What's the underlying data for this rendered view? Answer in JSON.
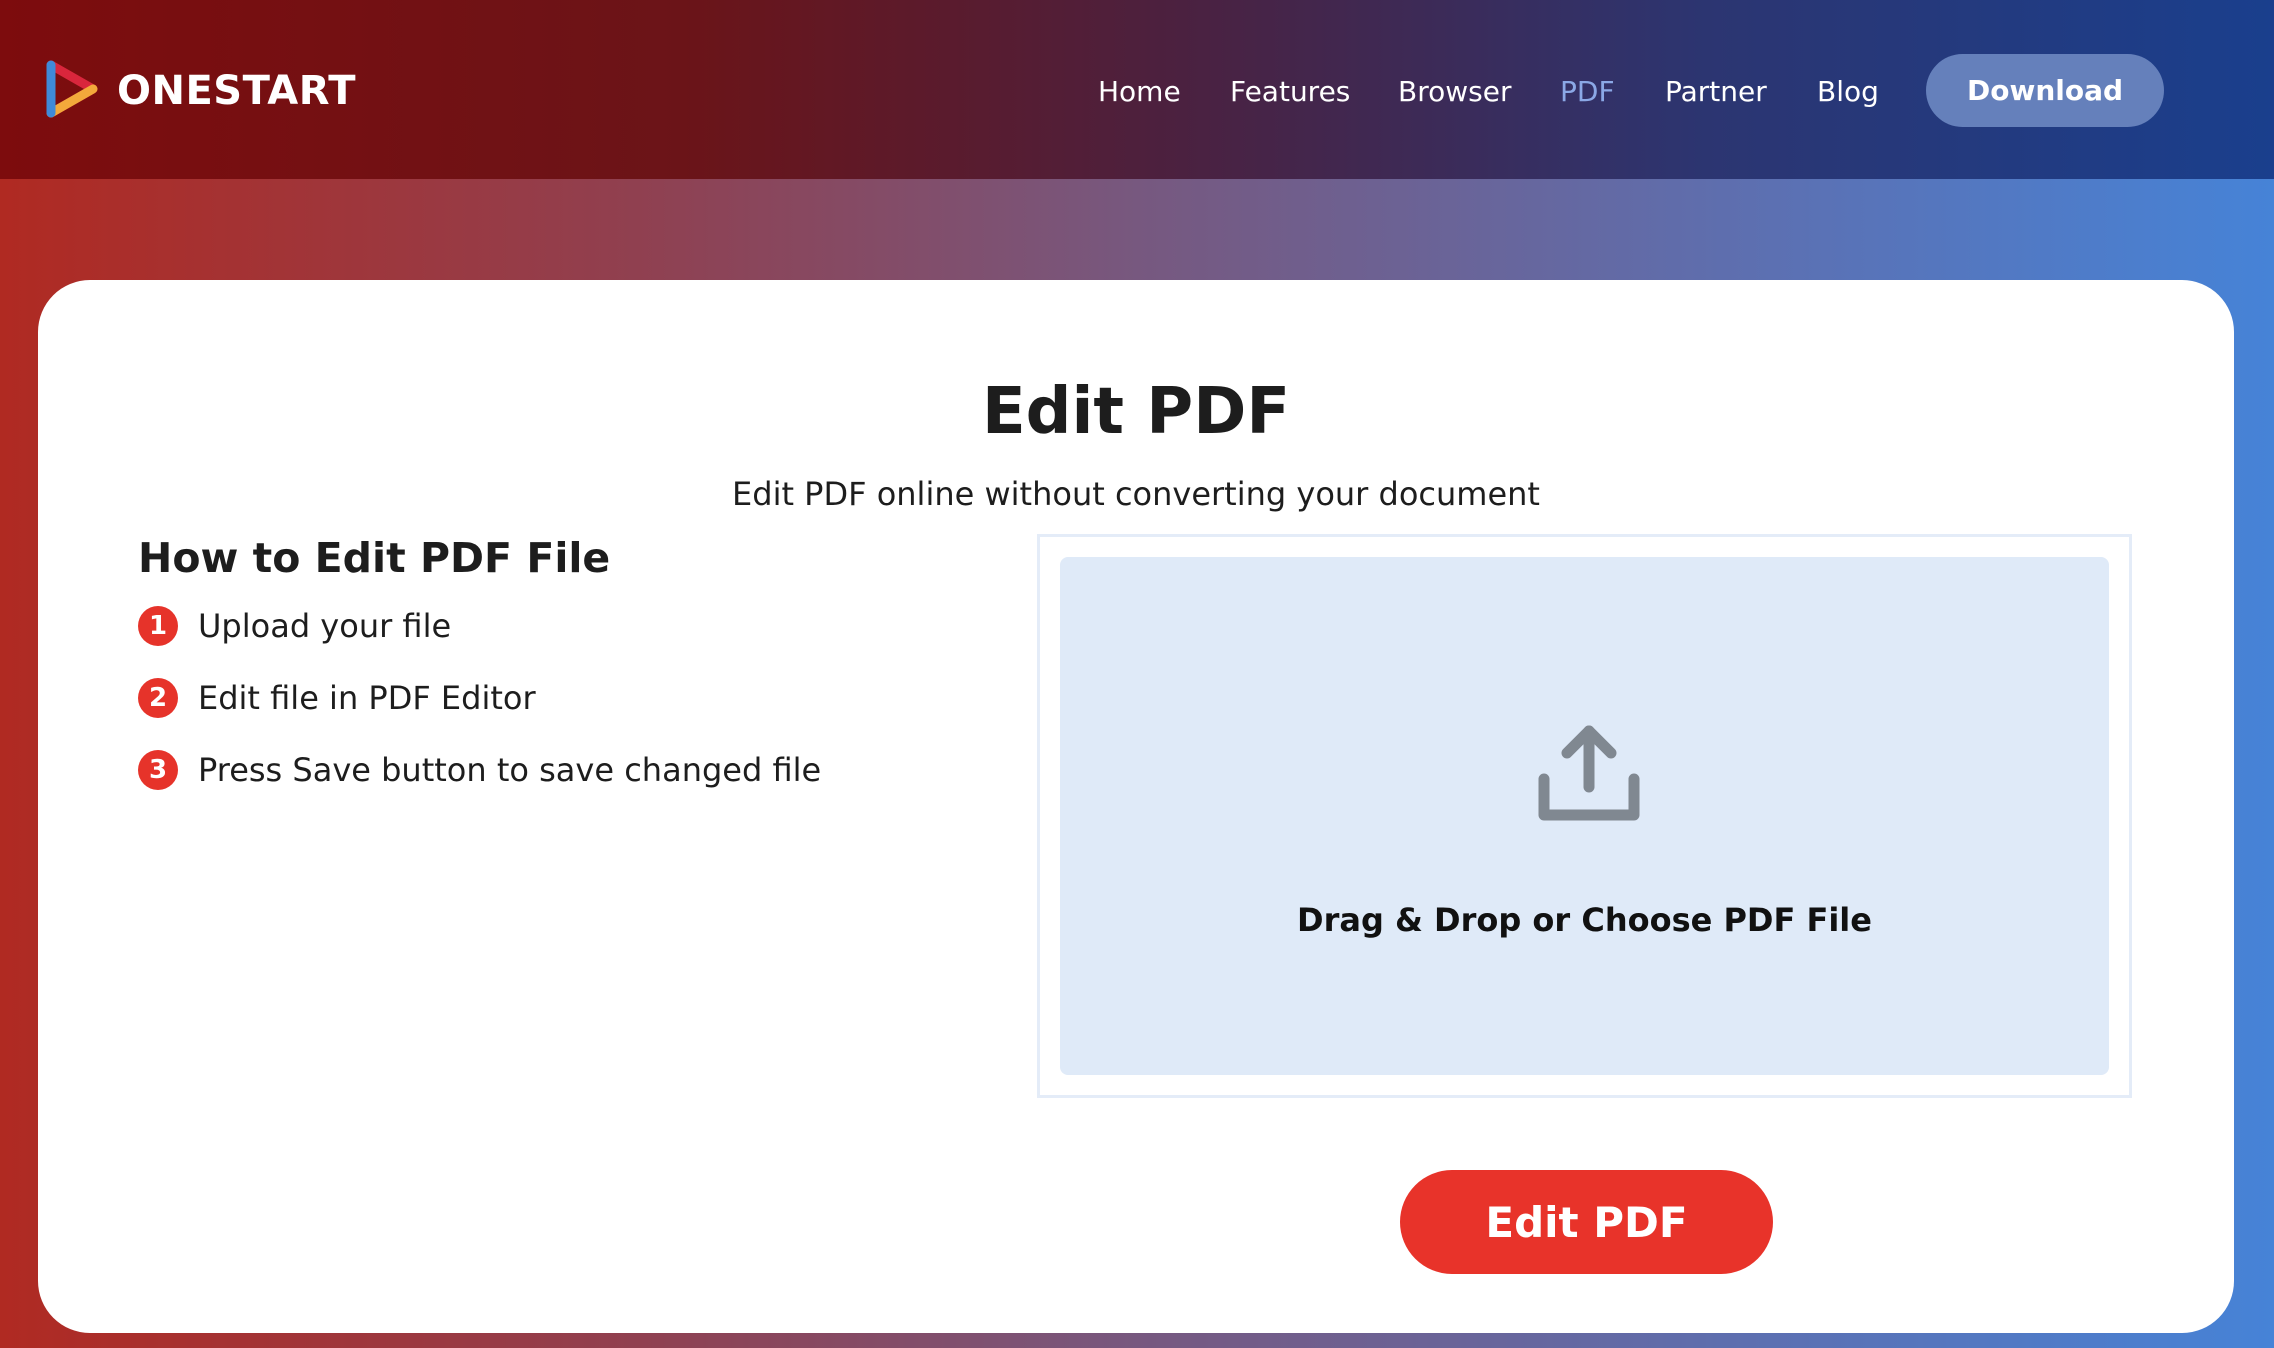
{
  "header": {
    "logo_text": "ONESTART",
    "nav": [
      {
        "label": "Home",
        "active": false
      },
      {
        "label": "Features",
        "active": false
      },
      {
        "label": "Browser",
        "active": false
      },
      {
        "label": "PDF",
        "active": true
      },
      {
        "label": "Partner",
        "active": false
      },
      {
        "label": "Blog",
        "active": false
      }
    ],
    "download_label": "Download"
  },
  "main": {
    "title": "Edit PDF",
    "subtitle": "Edit PDF online without converting your document",
    "how_to": {
      "title": "How to Edit PDF File",
      "steps": [
        {
          "number": "1",
          "text": "Upload your file"
        },
        {
          "number": "2",
          "text": "Edit file in PDF Editor"
        },
        {
          "number": "3",
          "text": "Press Save button to save changed file"
        }
      ]
    },
    "dropzone": {
      "icon": "upload-icon",
      "label": "Drag & Drop or Choose PDF File"
    },
    "edit_button_label": "Edit PDF"
  },
  "colors": {
    "accent_red": "#e8332a",
    "nav_active": "#8ba8e6",
    "download_button": "#6580bb",
    "dropzone_bg": "#dfeaf8"
  }
}
